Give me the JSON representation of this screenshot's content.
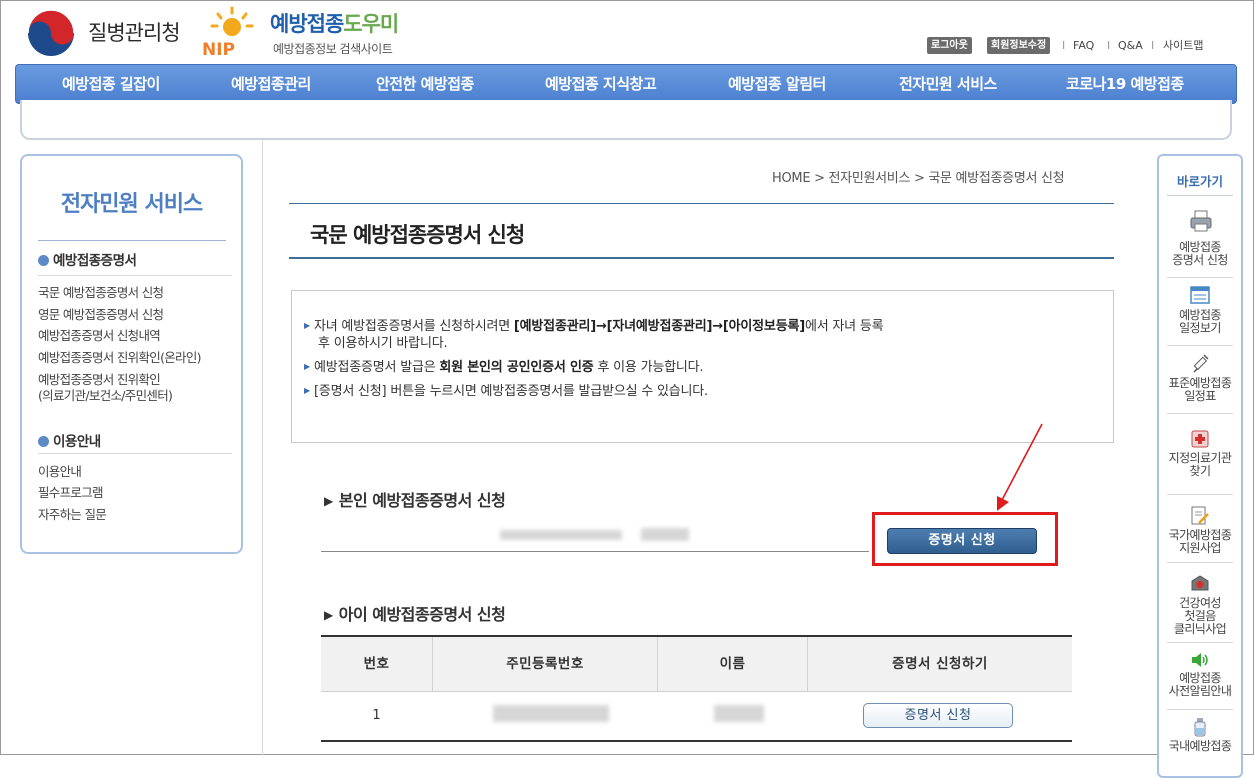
{
  "header": {
    "gov_name": "질병관리청",
    "site_title_main": "예방접종",
    "site_title_accent": "도우미",
    "site_subtitle": "예방접종정보 검색사이트",
    "logo_letters": "NIP",
    "util": {
      "logout": "로그아웃",
      "edit_profile": "회원정보수정",
      "faq": "FAQ",
      "qna": "Q&A",
      "sitemap": "사이트맵",
      "separator": "I"
    }
  },
  "gnb": [
    "예방접종 길잡이",
    "예방접종관리",
    "안전한 예방접종",
    "예방접종 지식창고",
    "예방접종 알림터",
    "전자민원 서비스",
    "코로나19 예방접종"
  ],
  "lnb": {
    "title": "전자민원 서비스",
    "section1": "예방접종증명서",
    "links1": [
      "국문 예방접종증명서 신청",
      "영문 예방접종증명서 신청",
      "예방접종증명서 신청내역",
      "예방접종증명서 진위확인(온라인)",
      "예방접종증명서 진위확인",
      "(의료기관/보건소/주민센터)"
    ],
    "section2": "이용안내",
    "links2": [
      "이용안내",
      "필수프로그램",
      "자주하는 질문"
    ]
  },
  "breadcrumb": "HOME > 전자민원서비스 > 국문 예방접종증명서 신청",
  "page_title": "국문 예방접종증명서 신청",
  "notice": {
    "bullet": "▶",
    "i1_pre": "자녀 예방접종증명서를 신청하시려면 ",
    "i1_bold": "[예방접종관리]→[자녀예방접종관리]→[아이정보등록]",
    "i1_post": "에서 자녀 등록",
    "i1_line2": "후 이용하시기 바랍니다.",
    "i2_pre": "예방접종증명서 발급은 ",
    "i2_bold": "회원 본인의 공인인증서 인증",
    "i2_post": " 후 이용 가능합니다.",
    "i3": "[증명서 신청] 버튼을 누르시면 예방접종증명서를 발급받으실 수 있습니다."
  },
  "self_section": {
    "marker": "▶",
    "title": "본인 예방접종증명서 신청",
    "button": "증명서 신청"
  },
  "child_section": {
    "marker": "▶",
    "title": "아이 예방접종증명서 신청",
    "columns": [
      "번호",
      "주민등록번호",
      "이름",
      "증명서 신청하기"
    ],
    "rows": [
      {
        "no": "1",
        "button": "증명서 신청"
      }
    ]
  },
  "quick": {
    "title": "바로가기",
    "items": [
      [
        "예방접종",
        "증명서 신청"
      ],
      [
        "예방접종",
        "일정보기"
      ],
      [
        "표준예방접종",
        "일정표"
      ],
      [
        "지정의료기관",
        "찾기"
      ],
      [
        "국가예방접종",
        "지원사업"
      ],
      [
        "건강여성",
        "첫걸음",
        "클리닉사업"
      ],
      [
        "예방접종",
        "사전알림안내"
      ],
      [
        "국내예방접종"
      ]
    ]
  },
  "colors": {
    "nav_blue": "#5086d4",
    "title_line": "#3e6d95",
    "button_dark": "#3b6a9a",
    "highlight_red": "#e01b1b"
  }
}
